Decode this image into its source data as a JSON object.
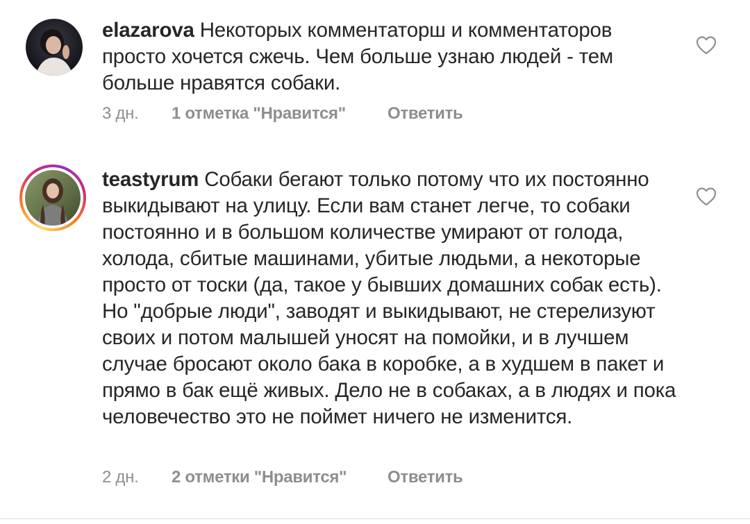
{
  "comments": [
    {
      "username": "elazarova",
      "text": "Некоторых комментаторш и комментаторов просто хочется сжечь. Чем больше узнаю людей - тем больше нравятся собаки.",
      "time": "3 дн.",
      "likes": "1 отметка \"Нравится\"",
      "reply": "Ответить",
      "avatar_icon": "profile-photo",
      "like_icon": "heart-outline-icon"
    },
    {
      "username": "teastyrum",
      "text": "Собаки бегают только потому что их постоянно выкидывают на улицу. Если вам станет легче, то собаки постоянно и в большом количестве умирают от голода, холода, сбитые машинами, убитые людьми, а некоторые просто от тоски (да, такое у бывших домашних собак есть). Но \"добрые люди\", заводят и выкидывают, не стерелизуют своих и потом малышей уносят на помойки, и в лучшем случае бросают около бака в коробке, а в худшем в пакет и прямо в бак ещё живых. Дело не в собаках, а в людях и пока человечество это не поймет ничего не изменится.",
      "time": "2 дн.",
      "likes": "2 отметки \"Нравится\"",
      "reply": "Ответить",
      "avatar_icon": "profile-photo",
      "like_icon": "heart-outline-icon",
      "has_story_ring": true
    }
  ],
  "colors": {
    "text": "#262626",
    "secondary": "#8e8e8e",
    "story_ring": [
      "#feda75",
      "#fa7e1e",
      "#d62976",
      "#962fbf"
    ]
  }
}
